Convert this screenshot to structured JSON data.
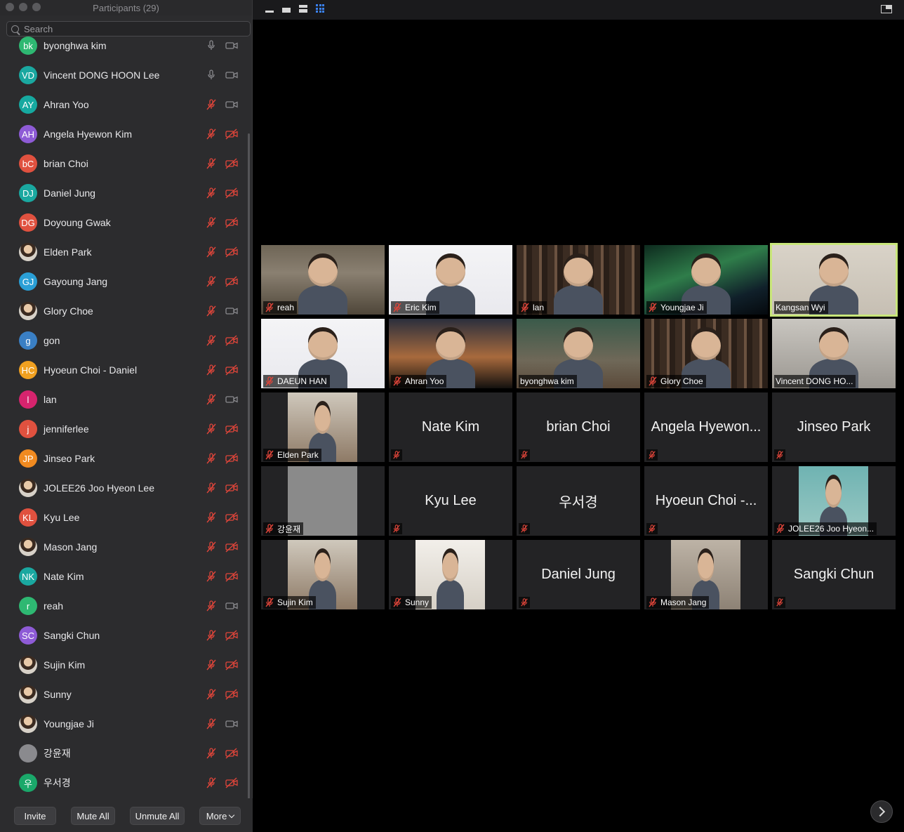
{
  "window": {
    "title": "Participants (29)"
  },
  "search": {
    "placeholder": "Search"
  },
  "participants": [
    {
      "initials": "bk",
      "name": "byonghwa  kim",
      "color": "#2eb872",
      "mic": "on",
      "video": "on"
    },
    {
      "initials": "VD",
      "name": "Vincent DONG HOON Lee",
      "color": "#1aa8a0",
      "mic": "on",
      "video": "on"
    },
    {
      "initials": "AY",
      "name": "Ahran Yoo",
      "color": "#16a9a0",
      "mic": "off",
      "video": "on"
    },
    {
      "initials": "AH",
      "name": "Angela Hyewon Kim",
      "color": "#8e5bd6",
      "mic": "off",
      "video": "off"
    },
    {
      "initials": "bC",
      "name": "brian Choi",
      "color": "#e0513f",
      "mic": "off",
      "video": "off"
    },
    {
      "initials": "DJ",
      "name": "Daniel Jung",
      "color": "#1aa8a0",
      "mic": "off",
      "video": "off"
    },
    {
      "initials": "DG",
      "name": "Doyoung Gwak",
      "color": "#e0513f",
      "mic": "off",
      "video": "off"
    },
    {
      "initials": "",
      "name": "Elden Park",
      "color": "photo",
      "mic": "off",
      "video": "off"
    },
    {
      "initials": "GJ",
      "name": "Gayoung Jang",
      "color": "#2a9fd6",
      "mic": "off",
      "video": "off"
    },
    {
      "initials": "",
      "name": "Glory Choe",
      "color": "photo",
      "mic": "off",
      "video": "on"
    },
    {
      "initials": "g",
      "name": "gon",
      "color": "#3a7fc4",
      "mic": "off",
      "video": "off"
    },
    {
      "initials": "HC",
      "name": "Hyoeun Choi - Daniel",
      "color": "#f0a020",
      "mic": "off",
      "video": "off"
    },
    {
      "initials": "l",
      "name": "lan",
      "color": "#d6246e",
      "mic": "off",
      "video": "on"
    },
    {
      "initials": "j",
      "name": "jenniferlee",
      "color": "#e0513f",
      "mic": "off",
      "video": "off"
    },
    {
      "initials": "JP",
      "name": "Jinseo Park",
      "color": "#f08a20",
      "mic": "off",
      "video": "off"
    },
    {
      "initials": "",
      "name": "JOLEE26 Joo Hyeon Lee",
      "color": "photo",
      "mic": "off",
      "video": "off"
    },
    {
      "initials": "KL",
      "name": "Kyu Lee",
      "color": "#e0513f",
      "mic": "off",
      "video": "off"
    },
    {
      "initials": "",
      "name": "Mason Jang",
      "color": "photo",
      "mic": "off",
      "video": "off"
    },
    {
      "initials": "NK",
      "name": "Nate Kim",
      "color": "#1aa8a0",
      "mic": "off",
      "video": "off"
    },
    {
      "initials": "r",
      "name": "reah",
      "color": "#2eb872",
      "mic": "off",
      "video": "on"
    },
    {
      "initials": "SC",
      "name": "Sangki Chun",
      "color": "#8e5bd6",
      "mic": "off",
      "video": "off"
    },
    {
      "initials": "",
      "name": "Sujin Kim",
      "color": "photo",
      "mic": "off",
      "video": "off"
    },
    {
      "initials": "",
      "name": "Sunny",
      "color": "photo",
      "mic": "off",
      "video": "off"
    },
    {
      "initials": "",
      "name": "Youngjae Ji",
      "color": "photo",
      "mic": "off",
      "video": "on"
    },
    {
      "initials": "",
      "name": "강윤재",
      "color": "#8a8a8e",
      "mic": "off",
      "video": "off"
    },
    {
      "initials": "우",
      "name": "우서경",
      "color": "#1aa86a",
      "mic": "off",
      "video": "off"
    }
  ],
  "footer": {
    "invite": "Invite",
    "mute_all": "Mute All",
    "unmute_all": "Unmute All",
    "more": "More"
  },
  "tiles": [
    {
      "name": "reah",
      "type": "video",
      "bg": "bg-room",
      "active": false
    },
    {
      "name": "Eric Kim",
      "type": "video",
      "bg": "bg-screen",
      "active": false
    },
    {
      "name": "lan",
      "type": "video",
      "bg": "bg-library",
      "active": false
    },
    {
      "name": "Youngjae Ji",
      "type": "video",
      "bg": "bg-aurora",
      "active": false
    },
    {
      "name": "Kangsan Wyi",
      "type": "video",
      "bg": "bg-wall",
      "active": true
    },
    {
      "name": "DAEUN HAN",
      "type": "video",
      "bg": "bg-screen",
      "active": false
    },
    {
      "name": "Ahran Yoo",
      "type": "video",
      "bg": "bg-sunset",
      "active": false
    },
    {
      "name": "byonghwa  kim",
      "type": "video",
      "bg": "bg-class",
      "active": false
    },
    {
      "name": "Glory Choe",
      "type": "video",
      "bg": "bg-library",
      "active": false
    },
    {
      "name": "Vincent DONG HO...",
      "type": "video",
      "bg": "bg-office",
      "active": false
    },
    {
      "name": "Elden Park",
      "type": "photo",
      "bg": "bg-street",
      "active": false
    },
    {
      "name": "Nate Kim",
      "type": "name",
      "active": false
    },
    {
      "name": "brian Choi",
      "type": "name",
      "active": false
    },
    {
      "name": "Angela Hyewon...",
      "type": "name",
      "active": false
    },
    {
      "name": "Jinseo Park",
      "type": "name",
      "active": false
    },
    {
      "name": "강윤재",
      "type": "photo",
      "bg": "bg-gray",
      "active": false
    },
    {
      "name": "Kyu Lee",
      "type": "name",
      "active": false
    },
    {
      "name": "우서경",
      "type": "name",
      "active": false
    },
    {
      "name": "Hyoeun Choi -...",
      "type": "name",
      "active": false
    },
    {
      "name": "JOLEE26 Joo Hyeon...",
      "type": "photo",
      "bg": "bg-teal",
      "active": false
    },
    {
      "name": "Sujin Kim",
      "type": "photo",
      "bg": "bg-street",
      "active": false
    },
    {
      "name": "Sunny",
      "type": "photo",
      "bg": "bg-light",
      "active": false
    },
    {
      "name": "Daniel Jung",
      "type": "name",
      "active": false
    },
    {
      "name": "Mason Jang",
      "type": "photo",
      "bg": "bg-studio",
      "active": false
    },
    {
      "name": "Sangki Chun",
      "type": "name",
      "active": false
    }
  ]
}
